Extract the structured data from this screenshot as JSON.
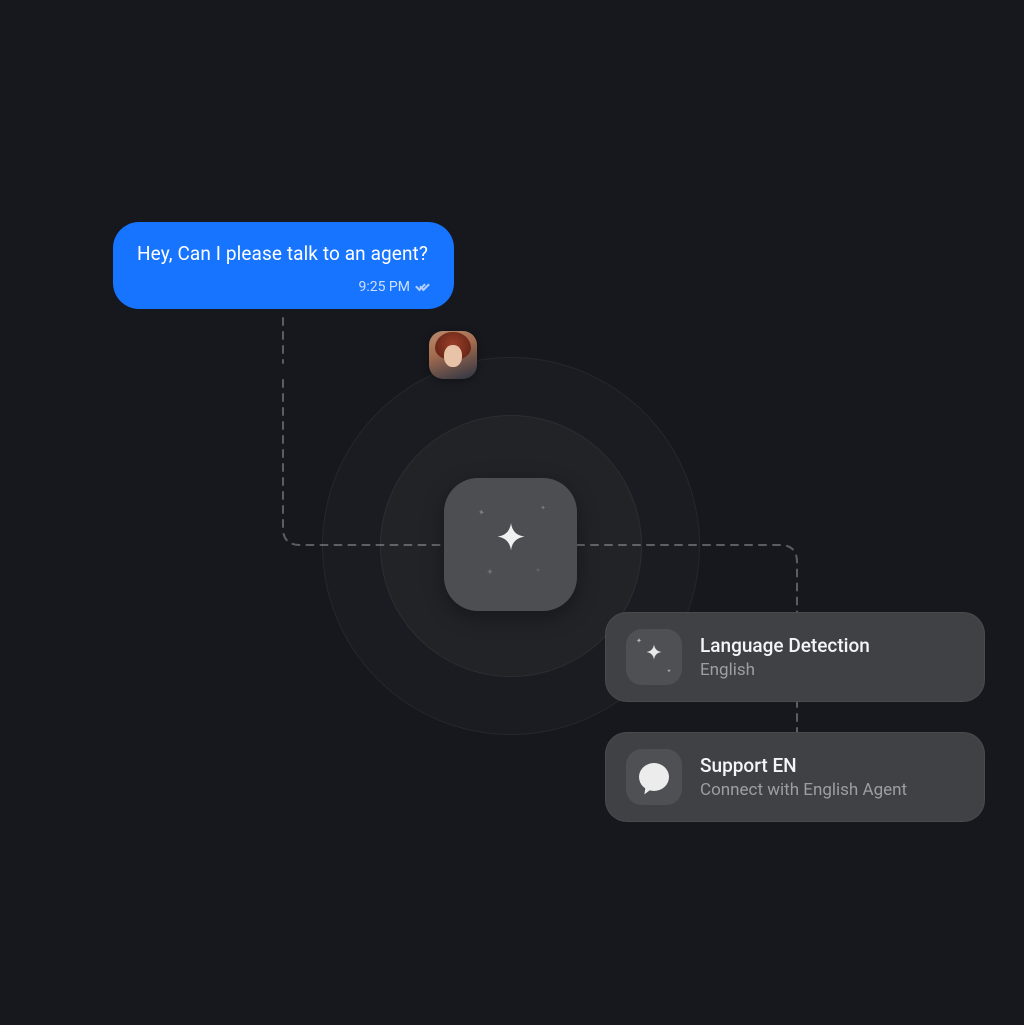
{
  "message": {
    "text": "Hey, Can I please talk to an agent?",
    "time": "9:25 PM"
  },
  "cards": {
    "language": {
      "title": "Language Detection",
      "subtitle": "English"
    },
    "support": {
      "title": "Support EN",
      "subtitle": "Connect with English Agent"
    }
  }
}
